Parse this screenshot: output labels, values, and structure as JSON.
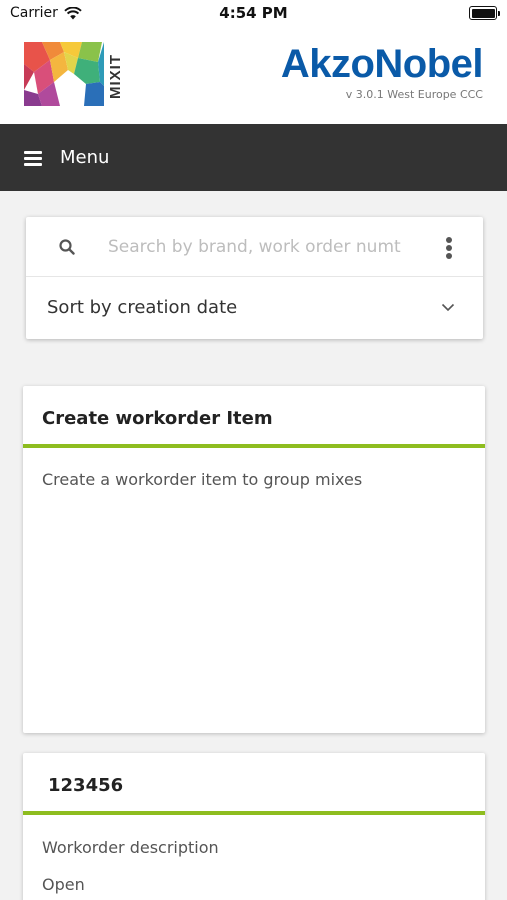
{
  "status_bar": {
    "carrier": "Carrier",
    "time": "4:54 PM",
    "wifi_icon": "wifi-icon",
    "battery_icon": "battery-icon"
  },
  "header": {
    "logo_text": "MIXIT",
    "brand": "AkzoNobel",
    "version": "v 3.0.1 West Europe CCC",
    "brand_color": "#0a5aa8"
  },
  "menu": {
    "label": "Menu",
    "icon": "hamburger-icon",
    "background": "#333333"
  },
  "search": {
    "placeholder": "Search by brand, work order numt",
    "value": "",
    "icon": "search-icon",
    "more_icon": "more-vertical-icon"
  },
  "sort": {
    "label": "Sort by creation date",
    "icon": "chevron-down-icon"
  },
  "cards": [
    {
      "title": "Create workorder Item",
      "description": "Create a workorder item to group mixes",
      "status": ""
    },
    {
      "title": "123456",
      "description": "Workorder description",
      "status": "Open"
    }
  ],
  "accent_color": "#8ebd1f"
}
